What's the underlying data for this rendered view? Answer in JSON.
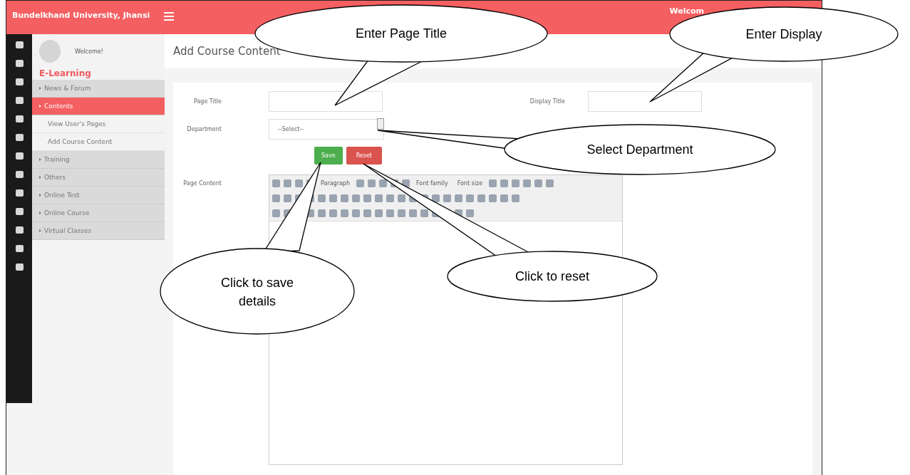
{
  "header": {
    "title": "Bundelkhand University, Jhansi",
    "welcome": "Welcom"
  },
  "sidebar": {
    "user": "Welcome!",
    "section": "E-Learning",
    "items": [
      {
        "label": "News & Forum",
        "selected": false
      },
      {
        "label": "Contents",
        "selected": true,
        "children": [
          {
            "label": "View User's Pages"
          },
          {
            "label": "Add Course Content"
          }
        ]
      },
      {
        "label": "Training",
        "selected": false
      },
      {
        "label": "Others",
        "selected": false
      },
      {
        "label": "Online Test",
        "selected": false
      },
      {
        "label": "Online Course",
        "selected": false
      },
      {
        "label": "Virtual Classes",
        "selected": false
      }
    ]
  },
  "page": {
    "title": "Add Course Content",
    "page_title": {
      "label": "Page Title"
    },
    "display_title": {
      "label": "Display Title"
    },
    "department": {
      "label": "Department",
      "value": "--Select--"
    },
    "buttons": [
      {
        "label": "Save",
        "kind": "save"
      },
      {
        "label": "Reset",
        "kind": "reset"
      }
    ],
    "content": {
      "label": "Page Content",
      "format": "Paragraph",
      "font_family": "Font family",
      "font_size": "Font size"
    }
  },
  "callouts": [
    {
      "text": "Enter Page Title"
    },
    {
      "text": "Enter Display"
    },
    {
      "text": "Select Department"
    },
    {
      "text": "Click to save details"
    },
    {
      "text": "Click to reset"
    }
  ]
}
